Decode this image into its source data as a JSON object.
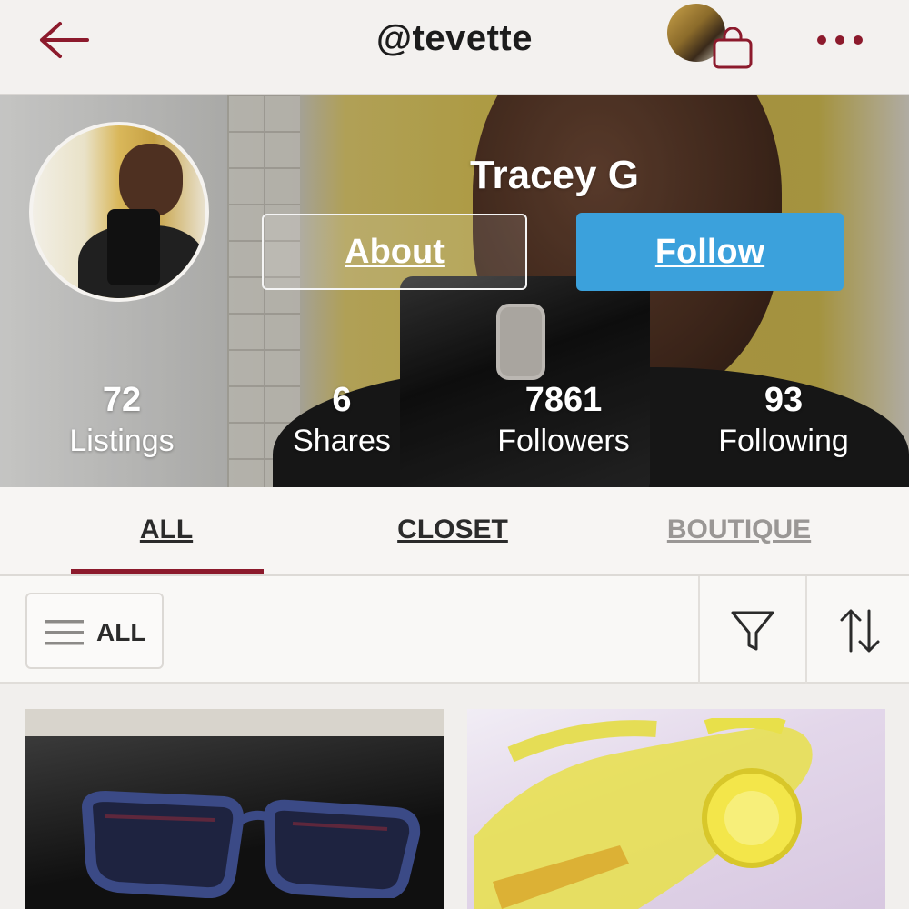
{
  "header": {
    "handle": "@tevette",
    "back_icon": "arrow-left-icon",
    "bag_icon": "shopping-bag-icon",
    "more_icon": "more-dots-icon"
  },
  "profile": {
    "name": "Tracey G",
    "about_label": "About",
    "follow_label": "Follow"
  },
  "stats": [
    {
      "value": "72",
      "label": "Listings"
    },
    {
      "value": "6",
      "label": "Shares"
    },
    {
      "value": "7861",
      "label": "Followers"
    },
    {
      "value": "93",
      "label": "Following"
    }
  ],
  "tabs": [
    {
      "label": "ALL",
      "active": true
    },
    {
      "label": "CLOSET",
      "active": false
    },
    {
      "label": "BOUTIQUE",
      "active": false
    }
  ],
  "filters": {
    "category_label": "ALL",
    "filter_icon": "funnel-icon",
    "sort_icon": "sort-arrows-icon"
  },
  "colors": {
    "accent": "#8c1a2c",
    "follow_button": "#3ba1dc",
    "inactive_tab": "#9a9795"
  }
}
